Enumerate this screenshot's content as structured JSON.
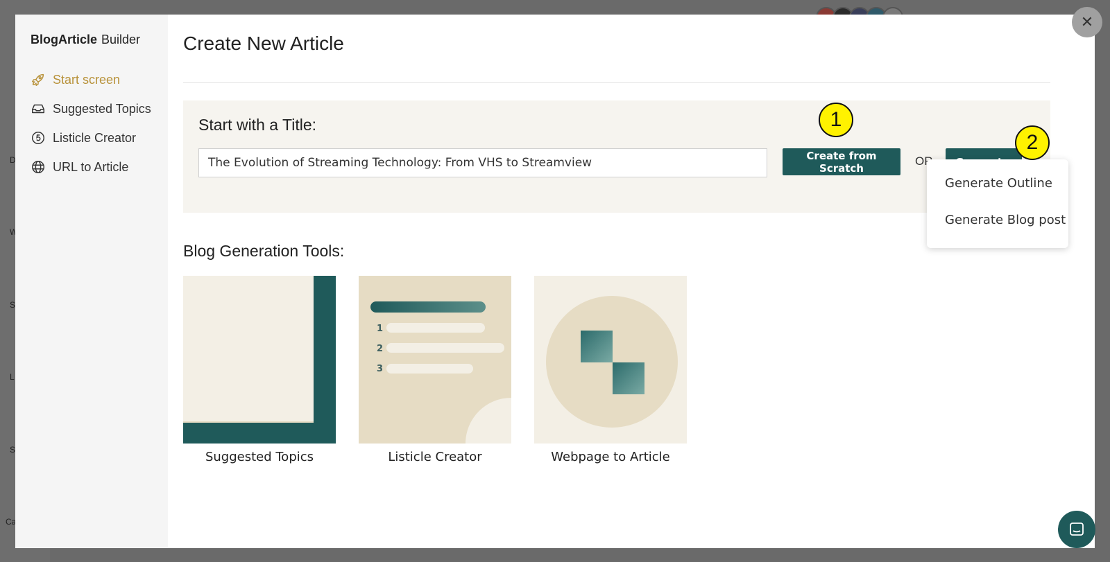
{
  "background": {
    "left_labels": [
      "D",
      "W",
      "S",
      "L",
      "Se",
      "Ca"
    ]
  },
  "sidebar": {
    "brand_bold": "BlogArticle",
    "brand_rest": "Builder",
    "items": [
      {
        "label": "Start screen",
        "icon": "rocket-icon",
        "active": true
      },
      {
        "label": "Suggested Topics",
        "icon": "inbox-icon",
        "active": false
      },
      {
        "label": "Listicle Creator",
        "icon": "numbered-circle-icon",
        "active": false
      },
      {
        "label": "URL to Article",
        "icon": "globe-icon",
        "active": false
      }
    ]
  },
  "main": {
    "title": "Create New Article",
    "title_panel": {
      "label": "Start with a Title:",
      "input_value": "The Evolution of Streaming Technology: From VHS to Streamview",
      "create_button": "Create from Scratch",
      "or_label": "OR",
      "generate_button": "Generate"
    },
    "tools_label": "Blog Generation Tools:",
    "tools": [
      {
        "label": "Suggested Topics"
      },
      {
        "label": "Listicle Creator",
        "list_numbers": [
          "1",
          "2",
          "3"
        ]
      },
      {
        "label": "Webpage to Article"
      }
    ]
  },
  "dropdown": {
    "options": [
      "Generate Outline",
      "Generate Blog post"
    ]
  },
  "callouts": [
    "1",
    "2"
  ],
  "colors": {
    "accent_teal": "#1f5a5a",
    "active_nav": "#b8923a",
    "panel_bg": "#f6f4ef",
    "callout_yellow": "#fff200"
  }
}
